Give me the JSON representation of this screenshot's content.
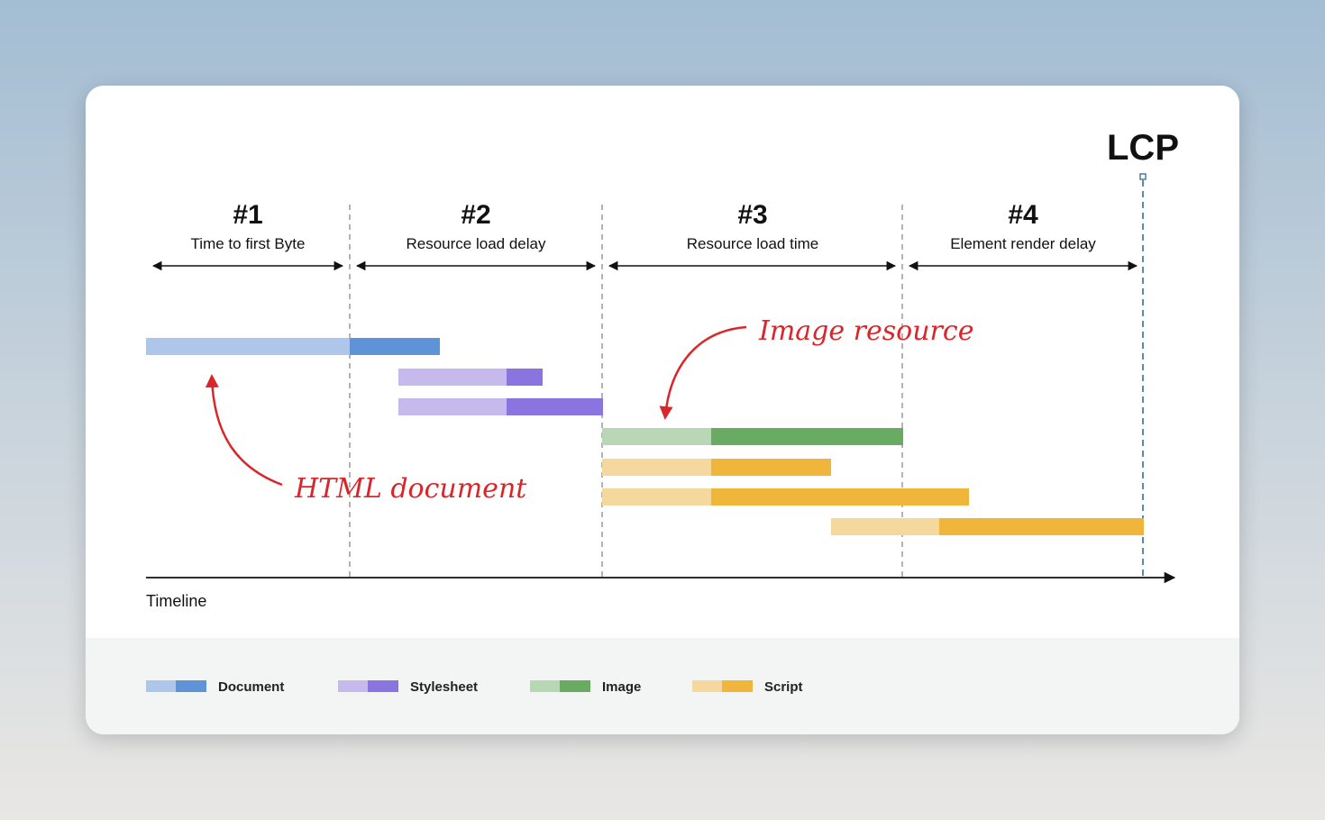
{
  "lcp_label": "LCP",
  "timeline_label": "Timeline",
  "phases": [
    {
      "num": "#1",
      "label": "Time to first Byte"
    },
    {
      "num": "#2",
      "label": "Resource load delay"
    },
    {
      "num": "#3",
      "label": "Resource load time"
    },
    {
      "num": "#4",
      "label": "Element render delay"
    }
  ],
  "annotations": {
    "image": "Image resource",
    "html": "HTML document"
  },
  "legend": [
    {
      "label": "Document",
      "light": "#aec6ea",
      "dark": "#5e93d8"
    },
    {
      "label": "Stylesheet",
      "light": "#c6b9ec",
      "dark": "#8a74e0"
    },
    {
      "label": "Image",
      "light": "#b8d8b5",
      "dark": "#6aab63"
    },
    {
      "label": "Script",
      "light": "#f5d89e",
      "dark": "#f0b63c"
    }
  ],
  "colors": {
    "annotation": "#d9262b",
    "lcp_marker": "#4a7f99"
  }
}
